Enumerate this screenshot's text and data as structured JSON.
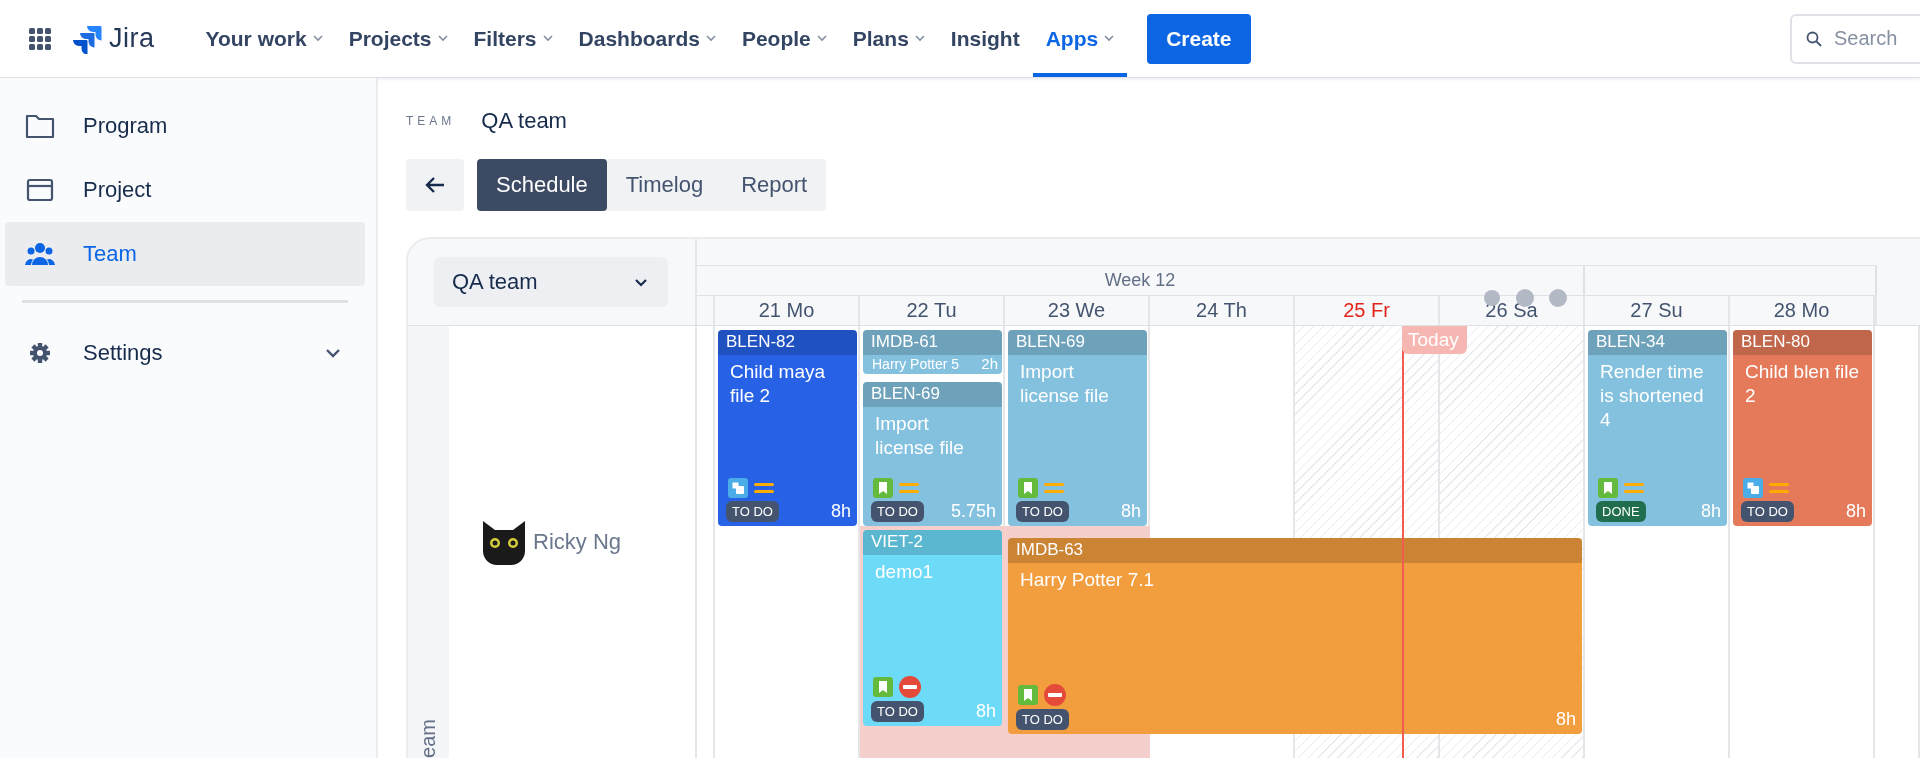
{
  "top_nav": {
    "product": "Jira",
    "items": [
      {
        "label": "Your work",
        "selected": false,
        "has_menu": true
      },
      {
        "label": "Projects",
        "selected": false,
        "has_menu": true
      },
      {
        "label": "Filters",
        "selected": false,
        "has_menu": true
      },
      {
        "label": "Dashboards",
        "selected": false,
        "has_menu": true
      },
      {
        "label": "People",
        "selected": false,
        "has_menu": true
      },
      {
        "label": "Plans",
        "selected": false,
        "has_menu": true
      },
      {
        "label": "Insight",
        "selected": false,
        "has_menu": false
      },
      {
        "label": "Apps",
        "selected": true,
        "has_menu": true
      }
    ],
    "create_button": "Create",
    "search": {
      "placeholder": "Search"
    }
  },
  "sidebar": {
    "items": [
      {
        "label": "Program",
        "kind": "folder",
        "selected": false
      },
      {
        "label": "Project",
        "kind": "window",
        "selected": false
      },
      {
        "label": "Team",
        "kind": "people",
        "selected": true
      }
    ],
    "settings": {
      "label": "Settings",
      "expanded": false
    }
  },
  "breadcrumb": {
    "label": "TEAM",
    "value": "QA team"
  },
  "tabs": [
    {
      "label": "Schedule",
      "selected": true
    },
    {
      "label": "Timelog",
      "selected": false
    },
    {
      "label": "Report",
      "selected": false
    }
  ],
  "schedule": {
    "team_select": "QA team",
    "week": "Week 12",
    "today_label": "Today",
    "group_label": "eam",
    "member": {
      "name": "Ricky Ng"
    },
    "days": [
      {
        "label": "21 Mo",
        "today": false,
        "non_working": false,
        "over_capacity": false
      },
      {
        "label": "22 Tu",
        "today": false,
        "non_working": false,
        "over_capacity": true
      },
      {
        "label": "23 We",
        "today": false,
        "non_working": false,
        "over_capacity": true
      },
      {
        "label": "24 Th",
        "today": false,
        "non_working": false,
        "over_capacity": false
      },
      {
        "label": "25 Fr",
        "today": true,
        "non_working": true,
        "over_capacity": false
      },
      {
        "label": "26 Sa",
        "today": false,
        "non_working": true,
        "over_capacity": false
      },
      {
        "label": "27 Su",
        "today": false,
        "non_working": false,
        "over_capacity": false
      },
      {
        "label": "28 Mo",
        "today": false,
        "non_working": false,
        "over_capacity": false
      }
    ],
    "cards": [
      {
        "kind": "full",
        "key": "BLEN-82",
        "title": "Child maya file 2",
        "subtask": true,
        "blocked": false,
        "status": "TO DO",
        "done": false,
        "hours": "8h",
        "color": "#2761e5"
      },
      {
        "kind": "compact",
        "key": "IMDB-61",
        "title": "Harry Potter 5",
        "hours": "2h",
        "color": "#84c1df"
      },
      {
        "kind": "full",
        "key": "BLEN-69",
        "title": "Import license file",
        "subtask": false,
        "blocked": false,
        "status": "TO DO",
        "done": false,
        "hours": "5.75h",
        "color": "#84c1df"
      },
      {
        "kind": "full",
        "key": "BLEN-69",
        "title": "Import license file",
        "subtask": false,
        "blocked": false,
        "status": "TO DO",
        "done": false,
        "hours": "8h",
        "color": "#84c1df"
      },
      {
        "kind": "full",
        "key": "VIET-2",
        "title": "demo1",
        "subtask": false,
        "blocked": true,
        "status": "TO DO",
        "done": false,
        "hours": "8h",
        "color": "#6ddaf7"
      },
      {
        "kind": "full",
        "key": "IMDB-63",
        "title": "Harry Potter 7.1",
        "subtask": false,
        "blocked": true,
        "status": "TO DO",
        "done": false,
        "hours": "8h",
        "color": "#f29d3e"
      },
      {
        "kind": "full",
        "key": "BLEN-34",
        "title": "Render time is shortened 4",
        "subtask": false,
        "blocked": false,
        "status": "DONE",
        "done": true,
        "hours": "8h",
        "color": "#84c1df"
      },
      {
        "kind": "full",
        "key": "BLEN-80",
        "title": "Child blen file 2",
        "subtask": true,
        "blocked": false,
        "status": "TO DO",
        "done": false,
        "hours": "8h",
        "color": "#e57a5a"
      }
    ]
  }
}
